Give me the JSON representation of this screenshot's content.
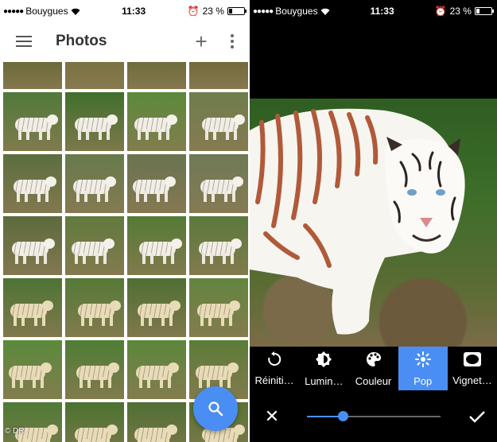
{
  "left_status": {
    "carrier": "Bouygues",
    "time": "11:33",
    "battery": "23 %",
    "battery_level": 0.23
  },
  "right_status": {
    "carrier": "Bouygues",
    "time": "11:33",
    "battery": "23 %",
    "battery_level": 0.23
  },
  "header": {
    "title": "Photos"
  },
  "grid": {
    "columns": 4,
    "thumbnails": [
      {
        "kind": "partial",
        "ground": "#6b6a3a"
      },
      {
        "kind": "partial",
        "ground": "#7a7242"
      },
      {
        "kind": "partial",
        "ground": "#6d6c3d"
      },
      {
        "kind": "partial",
        "ground": "#726a3c"
      },
      {
        "kind": "tiger",
        "ground": "#4f7a3a"
      },
      {
        "kind": "tiger",
        "ground": "#3f6f2c"
      },
      {
        "kind": "tiger",
        "ground": "#5b8a3a"
      },
      {
        "kind": "tiger",
        "ground": "#6f7d4c"
      },
      {
        "kind": "tiger",
        "ground": "#5c6e3f"
      },
      {
        "kind": "tiger",
        "ground": "#677a4b"
      },
      {
        "kind": "tiger",
        "ground": "#6a7350"
      },
      {
        "kind": "tiger",
        "ground": "#6e7a56"
      },
      {
        "kind": "tiger",
        "ground": "#5c6b3c"
      },
      {
        "kind": "tiger",
        "ground": "#617a3d"
      },
      {
        "kind": "tiger",
        "ground": "#557a36"
      },
      {
        "kind": "tiger",
        "ground": "#5a7a3c"
      },
      {
        "kind": "sand",
        "ground": "#4d7434"
      },
      {
        "kind": "sand",
        "ground": "#557a37"
      },
      {
        "kind": "sand",
        "ground": "#4f6f33"
      },
      {
        "kind": "sand",
        "ground": "#63853f"
      },
      {
        "kind": "sand",
        "ground": "#5a8a3b"
      },
      {
        "kind": "sand",
        "ground": "#4e7d34"
      },
      {
        "kind": "sand",
        "ground": "#5c873b"
      },
      {
        "kind": "sand",
        "ground": "#5b7c38"
      },
      {
        "kind": "sand",
        "ground": "#4f7a35"
      },
      {
        "kind": "sand",
        "ground": "#4b7230"
      },
      {
        "kind": "sand",
        "ground": "#506f33"
      },
      {
        "kind": "sand",
        "ground": "#5a7434"
      }
    ]
  },
  "watermark": "© DR",
  "editor": {
    "tools": [
      {
        "label": "Réiniti…",
        "icon": "reset-icon",
        "active": false
      },
      {
        "label": "Lumin…",
        "icon": "brightness-icon",
        "active": false
      },
      {
        "label": "Couleur",
        "icon": "palette-icon",
        "active": false
      },
      {
        "label": "Pop",
        "icon": "pop-icon",
        "active": true
      },
      {
        "label": "Vignet…",
        "icon": "vignette-icon",
        "active": false
      }
    ],
    "slider_value": 0.27,
    "colors": {
      "accent": "#4a8ef4",
      "background": "#000000"
    }
  }
}
